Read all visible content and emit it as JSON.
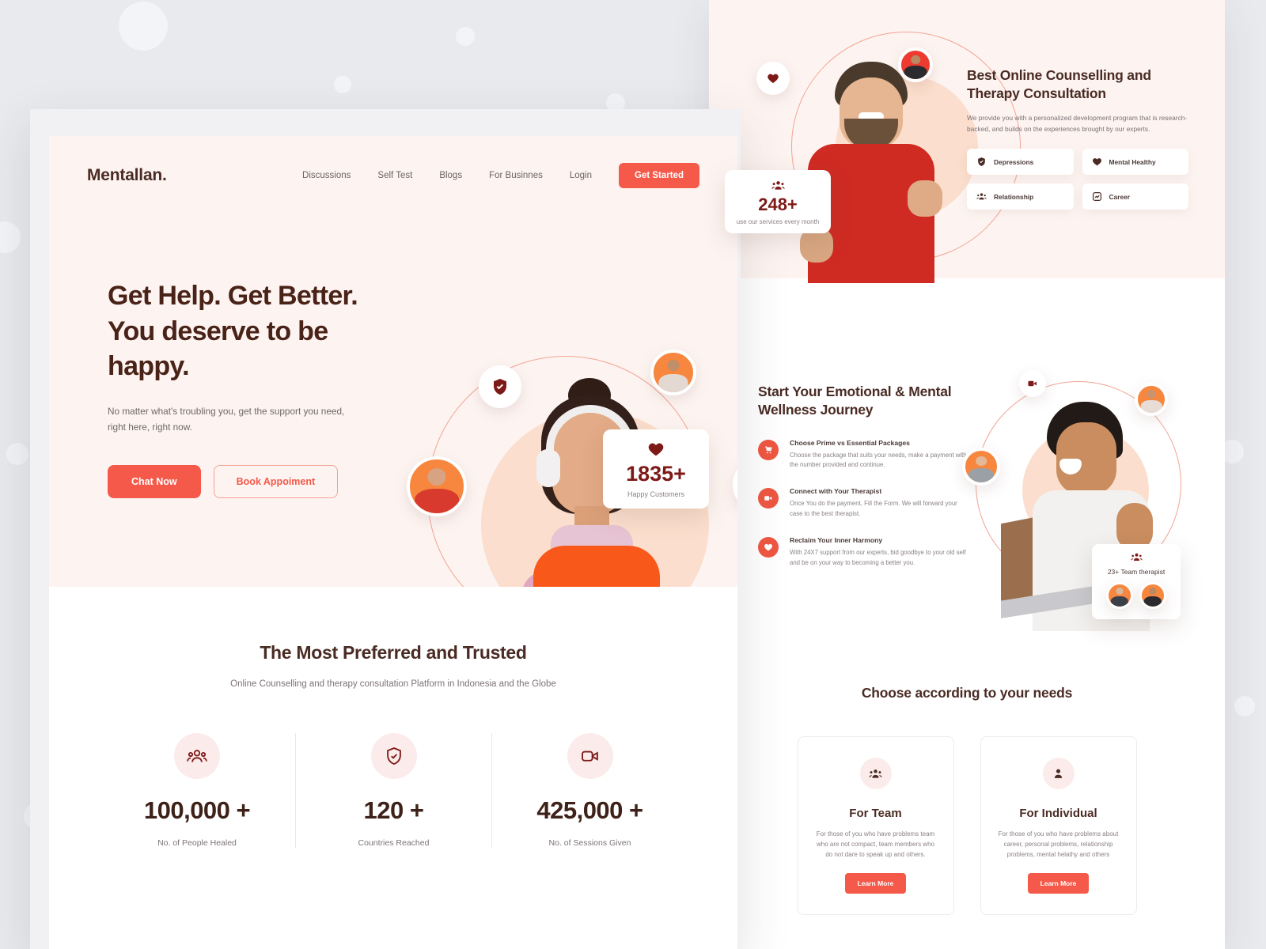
{
  "brand": {
    "name": "Mentallan."
  },
  "nav": {
    "links": [
      {
        "label": "Discussions"
      },
      {
        "label": "Self Test"
      },
      {
        "label": "Blogs"
      },
      {
        "label": "For Businnes"
      },
      {
        "label": "Login"
      }
    ],
    "cta": "Get Started"
  },
  "hero": {
    "title_line1": "Get Help. Get Better.",
    "title_line2": "You deserve to be",
    "title_line3": "happy.",
    "subtitle": "No matter what's troubling you, get the support you need, right here, right now.",
    "btn_primary": "Chat Now",
    "btn_secondary": "Book Appoiment",
    "card_happy": {
      "icon": "heart-icon",
      "value": "1835+",
      "caption": "Happy Customers"
    }
  },
  "trusted": {
    "title": "The Most Preferred and Trusted",
    "subtitle": "Online Counselling and therapy consultation Platform in Indonesia and the Globe",
    "stats": [
      {
        "icon": "people-group-icon",
        "value": "100,000 +",
        "label": "No. of People Healed"
      },
      {
        "icon": "shield-check-icon",
        "value": "120 +",
        "label": "Countries Reached"
      },
      {
        "icon": "video-camera-icon",
        "value": "425,000 +",
        "label": "No. of Sessions Given"
      }
    ]
  },
  "counselling": {
    "title_line1": "Best Online Counselling and",
    "title_line2": "Therapy Consultation",
    "description": "We provide you with a personalized development program that is research-backed, and builds on the experiences brought by our experts.",
    "chips": [
      {
        "icon": "shield-check-icon",
        "label": "Depressions"
      },
      {
        "icon": "heart-icon",
        "label": "Mental Healthy"
      },
      {
        "icon": "people-group-icon",
        "label": "Relationship"
      },
      {
        "icon": "chart-square-icon",
        "label": "Career"
      }
    ],
    "card_users": {
      "icon": "people-group-icon",
      "value": "248+",
      "caption": "use our services every month"
    }
  },
  "journey": {
    "title_line1": "Start Your Emotional & Mental",
    "title_line2": "Wellness Journey",
    "steps": [
      {
        "icon": "cart-icon",
        "title": "Choose Prime vs Essential Packages",
        "description": "Choose the package that suits your needs, make a payment with the number provided and continue."
      },
      {
        "icon": "video-camera-icon",
        "title": "Connect with Your Therapist",
        "description": "Once You do the payment, Fill the Form. We will forward your case to the best therapist."
      },
      {
        "icon": "heart-icon",
        "title": "Reclaim Your Inner Harmony",
        "description": "With 24X7 support from our experts, bid goodbye to your old self and be on your way to becoming a better you."
      }
    ],
    "card_team": {
      "icon": "people-group-icon",
      "label": "23+ Team therapist"
    }
  },
  "needs": {
    "title": "Choose according to your needs",
    "cards": [
      {
        "icon": "people-group-icon",
        "title": "For Team",
        "description": "For those of you who have problems team who are not compact, team members who do not dare to speak up and others.",
        "cta": "Learn More"
      },
      {
        "icon": "person-icon",
        "title": "For Individual",
        "description": "For those of you who have problems about career, personal problems, relationship problems, mental helathy and others",
        "cta": "Learn More"
      }
    ]
  },
  "colors": {
    "accent": "#f4594a",
    "deep_maroon": "#7d1a17",
    "dark_brown": "#4a2b24",
    "peach_bg": "#fdf4f1",
    "page_bg": "#e8eaee",
    "avatar_orange": "#f7873f"
  }
}
